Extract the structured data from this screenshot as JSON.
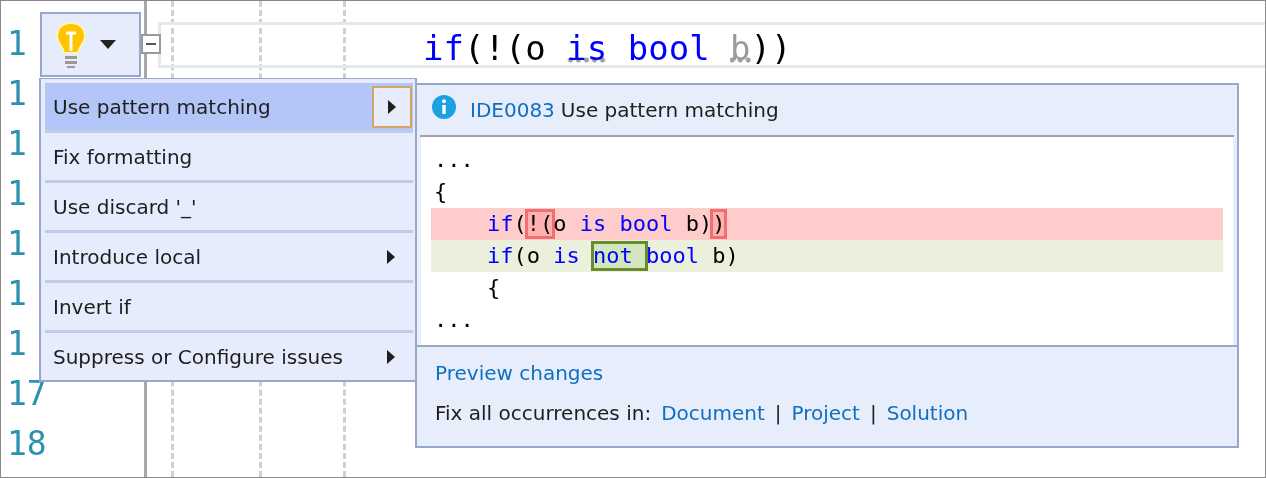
{
  "editor": {
    "line_numbers": [
      "1",
      "1",
      "1",
      "1",
      "1",
      "1",
      "1",
      "17",
      "18"
    ],
    "current_line": {
      "tokens": [
        {
          "text": "if",
          "kind": "keyword",
          "hint": false
        },
        {
          "text": "(!(o ",
          "kind": "plain",
          "hint": false
        },
        {
          "text": "is",
          "kind": "keyword",
          "hint": true
        },
        {
          "text": " bool ",
          "kind": "keyword",
          "hint": false
        },
        {
          "text": "b",
          "kind": "unused",
          "hint": true
        },
        {
          "text": "))",
          "kind": "plain",
          "hint": false
        }
      ]
    }
  },
  "quick_actions": [
    {
      "label": "Use pattern matching",
      "has_submenu": true,
      "selected": true
    },
    {
      "label": "Fix formatting",
      "has_submenu": false,
      "selected": false
    },
    {
      "label": "Use discard '_'",
      "has_submenu": false,
      "selected": false
    },
    {
      "label": "Introduce local",
      "has_submenu": true,
      "selected": false
    },
    {
      "label": "Invert if",
      "has_submenu": false,
      "selected": false
    },
    {
      "label": "Suppress or Configure issues",
      "has_submenu": true,
      "selected": false
    }
  ],
  "preview": {
    "diagnostic_id": "IDE0083",
    "title": "Use pattern matching",
    "lines": [
      {
        "kind": "context",
        "tokens": [
          {
            "text": "...",
            "kind": "plain",
            "highlight": false
          }
        ]
      },
      {
        "kind": "context",
        "tokens": [
          {
            "text": "{",
            "kind": "plain",
            "highlight": false
          }
        ]
      },
      {
        "kind": "removed",
        "tokens": [
          {
            "text": "    if",
            "kind": "keyword",
            "highlight": false
          },
          {
            "text": "(",
            "kind": "plain",
            "highlight": false
          },
          {
            "text": "!(",
            "kind": "plain",
            "highlight": true
          },
          {
            "text": "o ",
            "kind": "plain",
            "highlight": false
          },
          {
            "text": "is bool",
            "kind": "keyword",
            "highlight": false
          },
          {
            "text": " b)",
            "kind": "plain",
            "highlight": false
          },
          {
            "text": ")",
            "kind": "plain",
            "highlight": true
          }
        ]
      },
      {
        "kind": "added",
        "tokens": [
          {
            "text": "    if",
            "kind": "keyword",
            "highlight": false
          },
          {
            "text": "(o ",
            "kind": "plain",
            "highlight": false
          },
          {
            "text": "is ",
            "kind": "keyword",
            "highlight": false
          },
          {
            "text": "not ",
            "kind": "keyword",
            "highlight": true
          },
          {
            "text": "bool",
            "kind": "keyword",
            "highlight": false
          },
          {
            "text": " b)",
            "kind": "plain",
            "highlight": false
          }
        ]
      },
      {
        "kind": "context",
        "tokens": [
          {
            "text": "    {",
            "kind": "plain",
            "highlight": false
          }
        ]
      },
      {
        "kind": "context",
        "tokens": [
          {
            "text": "...",
            "kind": "plain",
            "highlight": false
          }
        ]
      }
    ],
    "preview_link": "Preview changes",
    "fix_all_label": "Fix all occurrences in:",
    "scopes": [
      {
        "label": "Document"
      },
      {
        "label": "Project",
        "separator": "|"
      },
      {
        "label": "Solution",
        "separator": "|"
      }
    ]
  }
}
